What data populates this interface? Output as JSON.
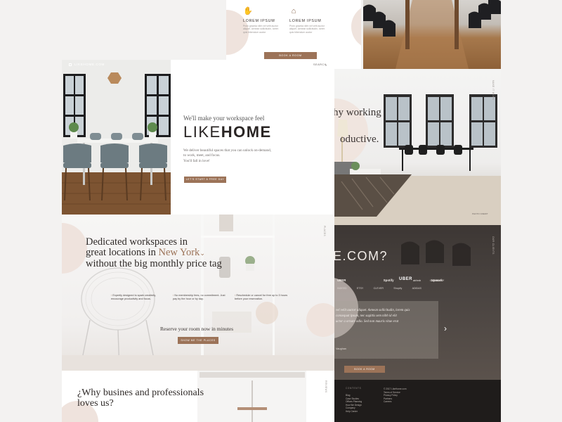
{
  "feature_card": {
    "items": [
      {
        "title": "LOREM IPSUM",
        "text": "Proin gravida nibh vel velit auctor aliquet. Aenean sollicitudin, lorem quis bibendum auctor"
      },
      {
        "title": "LOREM IPSUM",
        "text": "Proin gravida nibh vel velit auctor aliquet. Aenean sollicitudin, lorem quis bibendum auctor"
      }
    ],
    "button": "BOOK A ROOM"
  },
  "hero": {
    "logo": "LIKEHOME.COM",
    "search": "SEARCH",
    "tagline": "We'll make your workspace feel",
    "brand_part1": "LIKE",
    "brand_part2": "HOME",
    "desc": "We deliver beautiful spaces that you can unlock on-demand, to work, meet, and focus.",
    "fall": "You'll fall in love!",
    "cta": "LET'S START A FREE DAY"
  },
  "right_photo": {
    "heading1": "hy working",
    "heading2": "oductive.",
    "side_label": "MAKE IT WORK",
    "credit": "PHOTO CREDIT"
  },
  "dark_section": {
    "heading": "E.COM?",
    "side_label": "OUR CLIENTS",
    "logos_row1": [
      "UBER",
      "Spotify",
      "Upwork",
      "UBER",
      "airbnb",
      "CLEANLY"
    ],
    "logos_row2": [
      "INDEED",
      "ETSY",
      "CLEVER",
      "Shopify",
      "ADIDAS"
    ],
    "quote1": "vel velit auctor aliquet. Aenean sollicitudin, lorem quis",
    "quote2": "consequat ipsum, nec sagittis sem nibh id elit",
    "quote3": "uctor a ornare odio. Sed non mauris vitae erat",
    "author": "Vaughan",
    "arrow": "›",
    "button": "BOOK A ROOM"
  },
  "footer": {
    "heading": "CONTENTS",
    "col1": [
      "Blog",
      "Case Studies",
      "Offices Planning",
      "How We Design",
      "Company",
      "Help Center"
    ],
    "col2": [
      "© 2017 LikeHome.com",
      "Terms of Service",
      "Privacy Policy",
      "Partners",
      "Careers"
    ]
  },
  "mid": {
    "line1": "Dedicated workspaces in",
    "line2a": "great locations in ",
    "line2b": "New York",
    "line2c": "⌄",
    "line3": "without the big monthly price tag",
    "side_label": "PLACES",
    "features": [
      {
        "text": "Expertly designed to spark creativity, encourage productivity and focus."
      },
      {
        "text": "No membership fees, no commitment. Just pay by the hour or by day."
      },
      {
        "text": "Reschedule or cancel for free up to 3 hours before your reservation."
      }
    ],
    "reserve": "Reserve your room now in minutes",
    "button": "SHOW ME THE PLACES"
  },
  "bottom": {
    "line1": "¿Why busines and professionals",
    "line2": "loves us?",
    "side_label": "REVIEWS"
  },
  "colors": {
    "accent": "#9c7358",
    "blush": "#efe3dd",
    "dark": "#1f1c1b"
  }
}
